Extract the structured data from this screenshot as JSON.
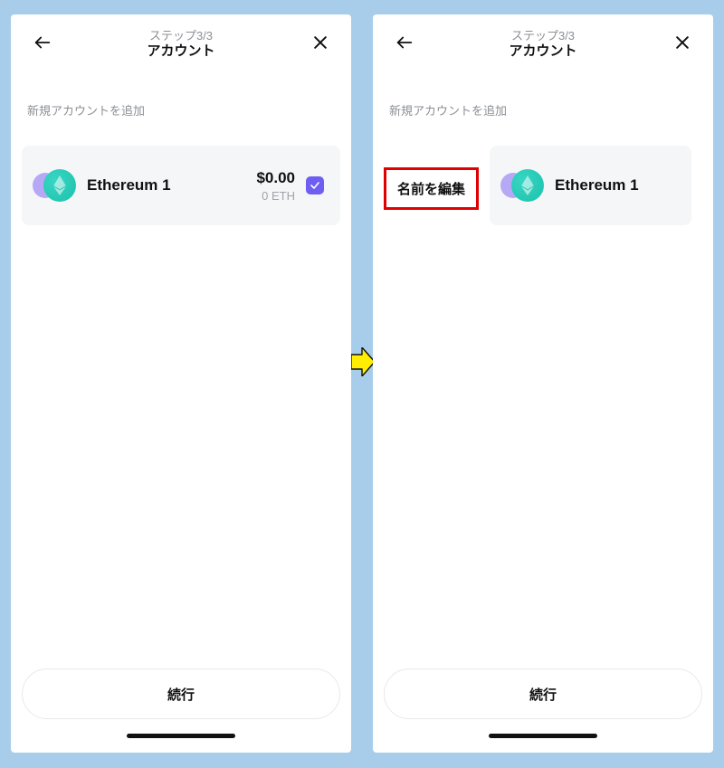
{
  "left": {
    "header": {
      "step": "ステップ3/3",
      "title": "アカウント"
    },
    "section_label": "新規アカウントを追加",
    "account": {
      "name": "Ethereum 1",
      "fiat": "$0.00",
      "crypto": "0 ETH",
      "checked": true
    },
    "continue_label": "続行"
  },
  "right": {
    "header": {
      "step": "ステップ3/3",
      "title": "アカウント"
    },
    "section_label": "新規アカウントを追加",
    "edit_name_label": "名前を編集",
    "account": {
      "name": "Ethereum 1"
    },
    "continue_label": "続行"
  }
}
